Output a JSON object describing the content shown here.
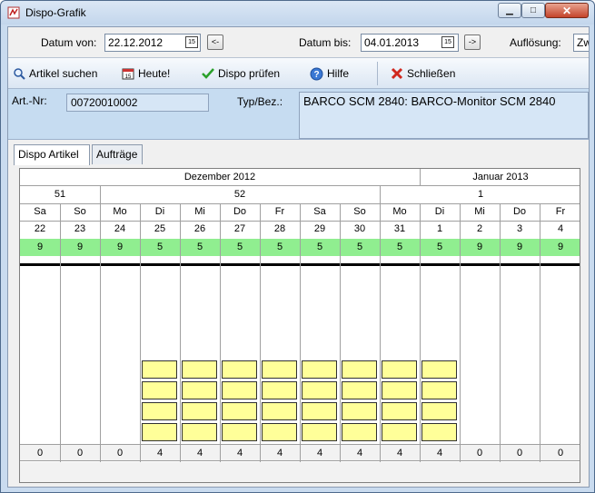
{
  "window": {
    "title": "Dispo-Grafik"
  },
  "datebar": {
    "datum_von_label": "Datum von:",
    "datum_von_value": "22.12.2012",
    "prev_label": "<-",
    "datum_bis_label": "Datum bis:",
    "datum_bis_value": "04.01.2013",
    "next_label": "->",
    "aufloesung_label": "Auflösung:",
    "aufloesung_value": "Zw",
    "cal_icon_text": "15"
  },
  "toolbar": {
    "artikel_suchen": "Artikel suchen",
    "heute": "Heute!",
    "dispo_pruefen": "Dispo prüfen",
    "hilfe": "Hilfe",
    "schliessen": "Schließen"
  },
  "article": {
    "art_nr_label": "Art.-Nr:",
    "art_nr_value": "00720010002",
    "typ_label": "Typ/Bez.:",
    "typ_value": "BARCO SCM 2840: BARCO-Monitor SCM 2840"
  },
  "tabs": [
    {
      "label": "Dispo Artikel",
      "active": true
    },
    {
      "label": "Aufträge",
      "active": false
    }
  ],
  "months": [
    {
      "label": "Dezember 2012"
    },
    {
      "label": "Januar 2013"
    }
  ],
  "weeks": [
    {
      "label": "51"
    },
    {
      "label": "52"
    },
    {
      "label": "1"
    }
  ],
  "days": [
    {
      "dow": "Sa",
      "day": "22",
      "avail": "9",
      "count": "0",
      "blocks": 0
    },
    {
      "dow": "So",
      "day": "23",
      "avail": "9",
      "count": "0",
      "blocks": 0
    },
    {
      "dow": "Mo",
      "day": "24",
      "avail": "9",
      "count": "0",
      "blocks": 0
    },
    {
      "dow": "Di",
      "day": "25",
      "avail": "5",
      "count": "4",
      "blocks": 4
    },
    {
      "dow": "Mi",
      "day": "26",
      "avail": "5",
      "count": "4",
      "blocks": 4
    },
    {
      "dow": "Do",
      "day": "27",
      "avail": "5",
      "count": "4",
      "blocks": 4
    },
    {
      "dow": "Fr",
      "day": "28",
      "avail": "5",
      "count": "4",
      "blocks": 4
    },
    {
      "dow": "Sa",
      "day": "29",
      "avail": "5",
      "count": "4",
      "blocks": 4
    },
    {
      "dow": "So",
      "day": "30",
      "avail": "5",
      "count": "4",
      "blocks": 4
    },
    {
      "dow": "Mo",
      "day": "31",
      "avail": "5",
      "count": "4",
      "blocks": 4
    },
    {
      "dow": "Di",
      "day": "1",
      "avail": "5",
      "count": "4",
      "blocks": 4
    },
    {
      "dow": "Mi",
      "day": "2",
      "avail": "9",
      "count": "0",
      "blocks": 0
    },
    {
      "dow": "Do",
      "day": "3",
      "avail": "9",
      "count": "0",
      "blocks": 0
    },
    {
      "dow": "Fr",
      "day": "4",
      "avail": "9",
      "count": "0",
      "blocks": 0
    }
  ],
  "colors": {
    "available": "#90ee90",
    "booked": "#ffff99",
    "article_panel": "#c6dcf1"
  }
}
